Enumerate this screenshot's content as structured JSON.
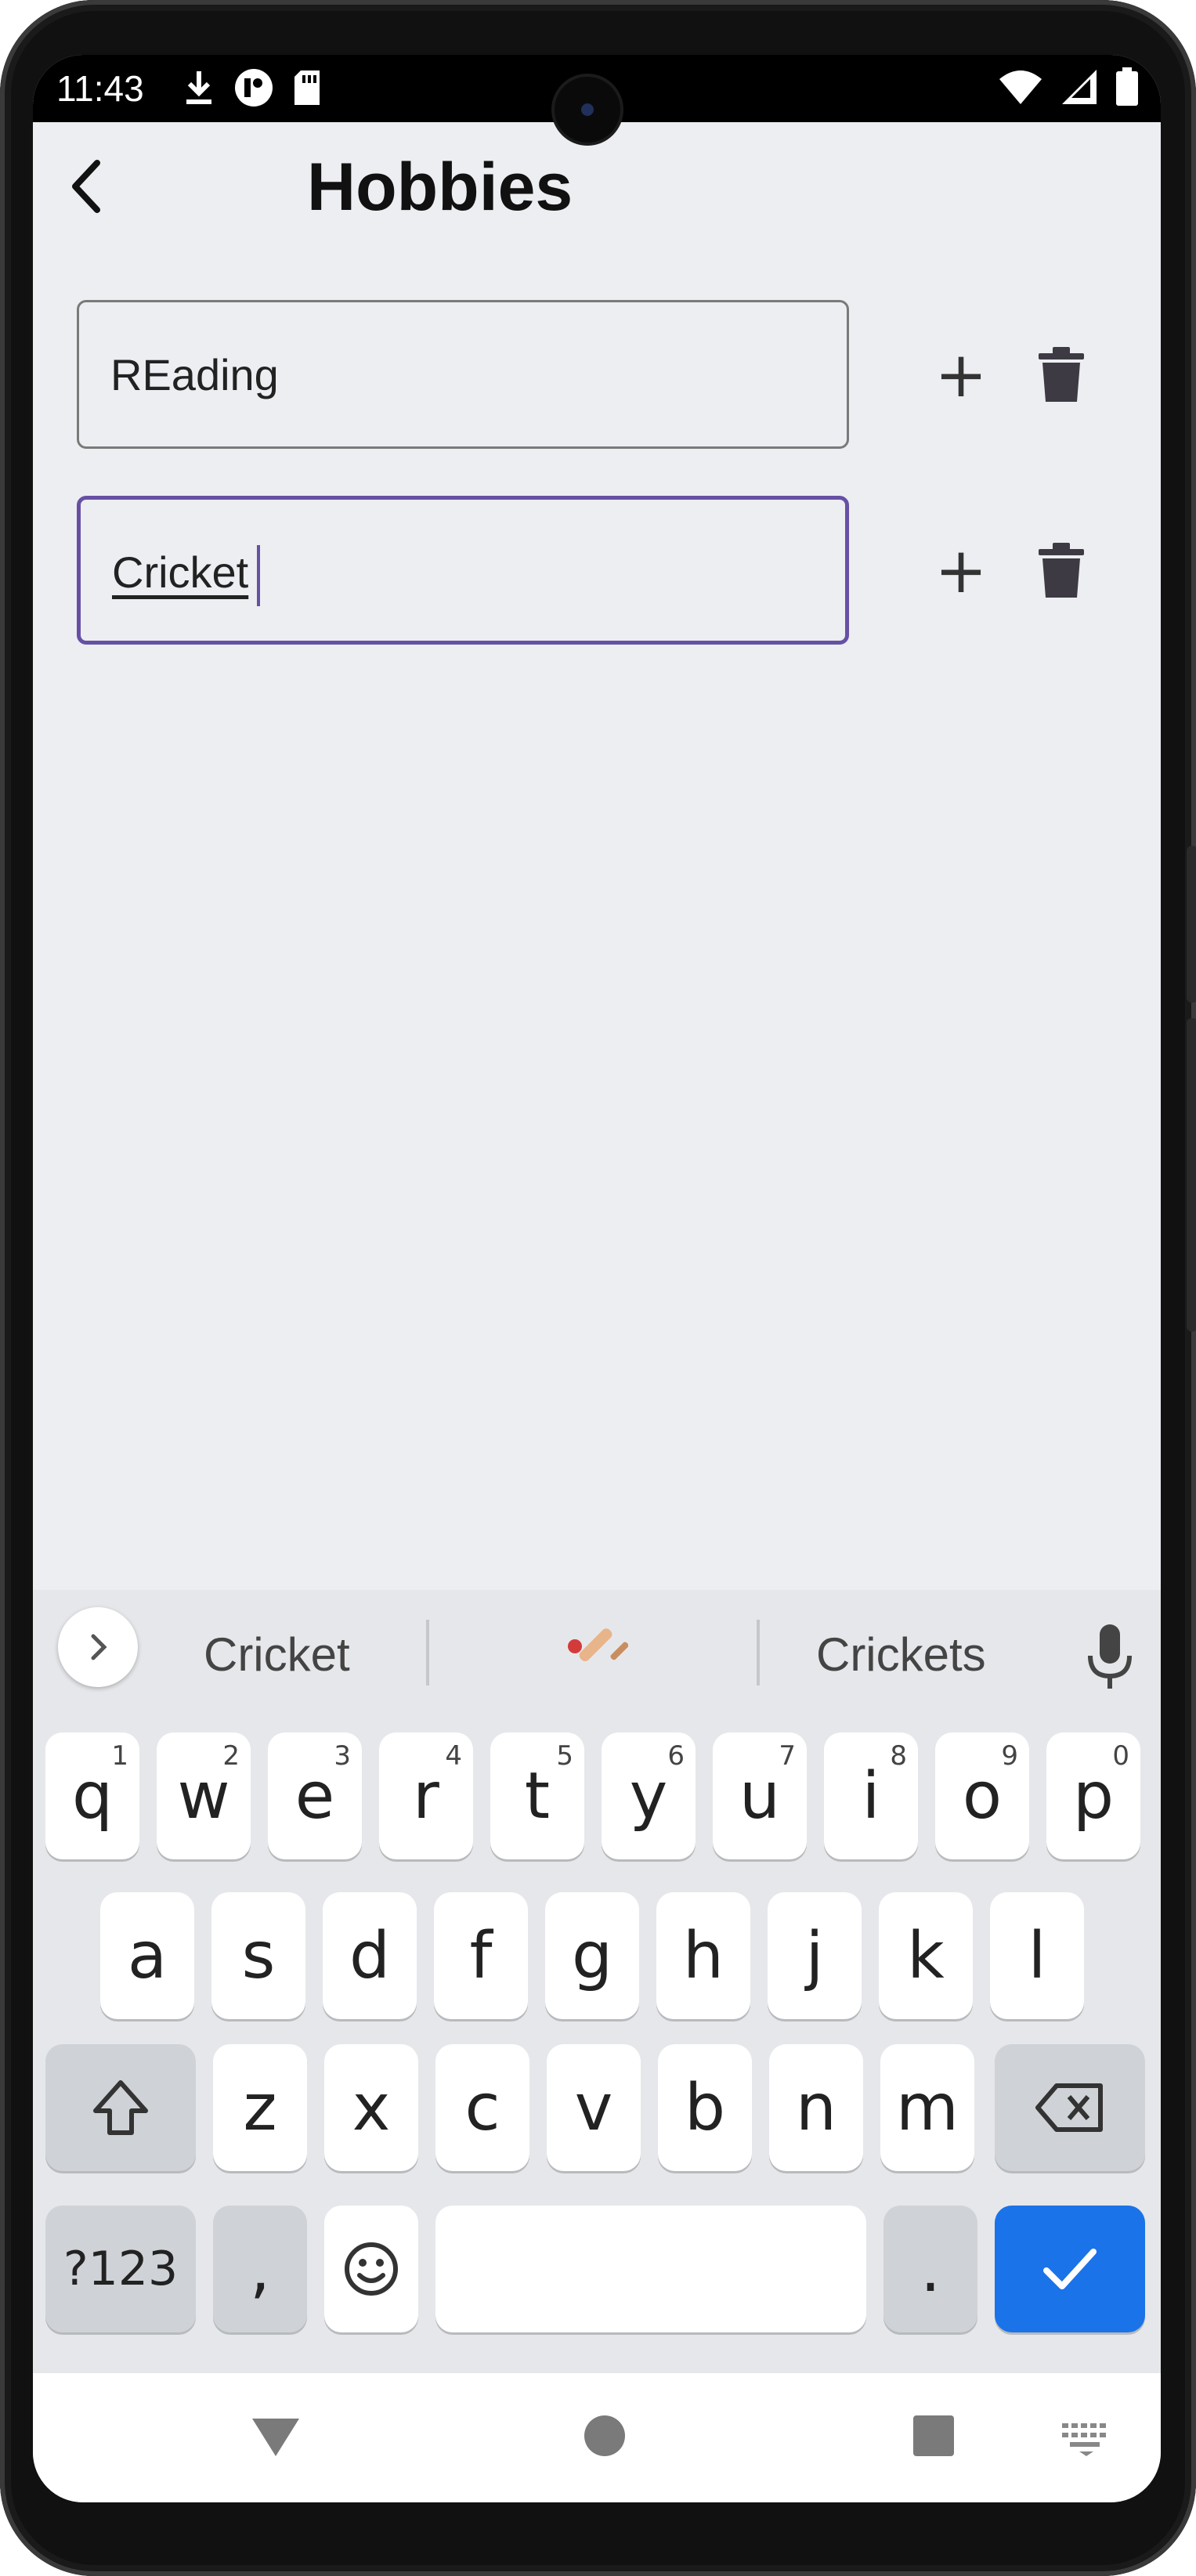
{
  "statusbar": {
    "time": "11:43"
  },
  "appbar": {
    "title": "Hobbies"
  },
  "hobbies": [
    {
      "value": "REading"
    },
    {
      "value": "Cricket"
    }
  ],
  "keyboard": {
    "suggestions": [
      "Cricket",
      "Crickets"
    ],
    "row1": [
      {
        "key": "q",
        "hint": "1"
      },
      {
        "key": "w",
        "hint": "2"
      },
      {
        "key": "e",
        "hint": "3"
      },
      {
        "key": "r",
        "hint": "4"
      },
      {
        "key": "t",
        "hint": "5"
      },
      {
        "key": "y",
        "hint": "6"
      },
      {
        "key": "u",
        "hint": "7"
      },
      {
        "key": "i",
        "hint": "8"
      },
      {
        "key": "o",
        "hint": "9"
      },
      {
        "key": "p",
        "hint": "0"
      }
    ],
    "row2": [
      "a",
      "s",
      "d",
      "f",
      "g",
      "h",
      "j",
      "k",
      "l"
    ],
    "row3": [
      "z",
      "x",
      "c",
      "v",
      "b",
      "n",
      "m"
    ],
    "symbols_label": "?123",
    "comma": ",",
    "period": ".",
    "accent_color": "#1a73e8"
  }
}
